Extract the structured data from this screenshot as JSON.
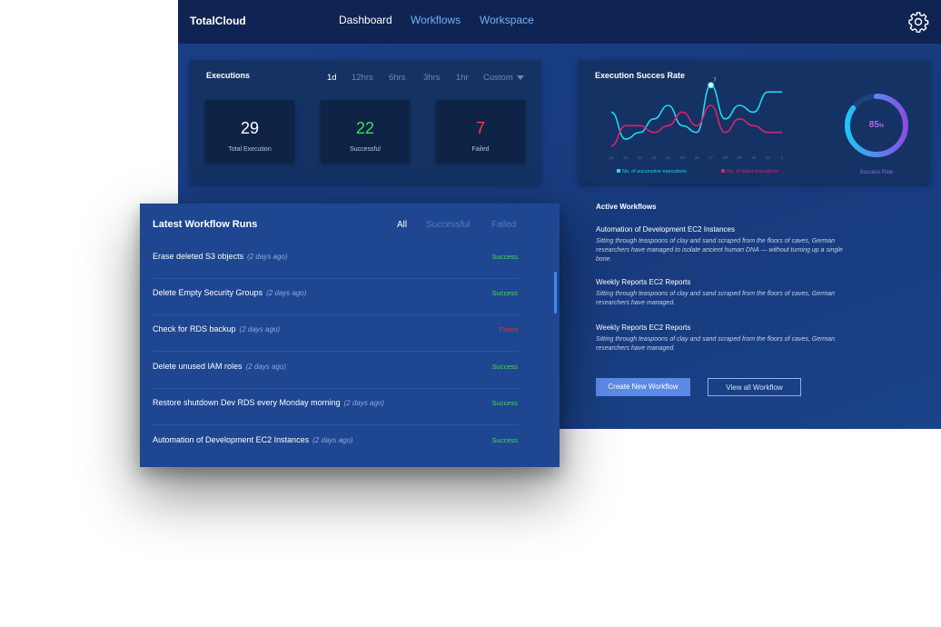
{
  "header": {
    "brand": "TotalCloud",
    "nav": [
      {
        "label": "Dashboard",
        "color": "#ffffff"
      },
      {
        "label": "Workflows",
        "color": "#6fb2ff"
      },
      {
        "label": "Workspace",
        "color": "#6fb2ff"
      }
    ],
    "settings_icon": "gear-icon"
  },
  "executions": {
    "title": "Executions",
    "ranges": [
      {
        "label": "1d",
        "active": true
      },
      {
        "label": "12hrs",
        "active": false
      },
      {
        "label": "6hrs",
        "active": false
      },
      {
        "label": "3hrs",
        "active": false
      },
      {
        "label": "1hr",
        "active": false
      },
      {
        "label": "Custom",
        "active": false
      }
    ],
    "stats": [
      {
        "value": "29",
        "label": "Total Execution",
        "color": "#ffffff"
      },
      {
        "value": "22",
        "label": "Successful",
        "color": "#3ee04a"
      },
      {
        "value": "7",
        "label": "Failed",
        "color": "#ff3b3b"
      }
    ]
  },
  "success_rate": {
    "title": "Execution Succes Rate",
    "ring_value": "85",
    "ring_unit": "%",
    "ring_label": "Success Rate",
    "ring_fraction": 0.85,
    "legend": [
      {
        "label": "No. of successive executions",
        "color": "#22d7f0"
      },
      {
        "label": "No. of failed executions",
        "color": "#e0206a"
      }
    ]
  },
  "chart_data": {
    "type": "line",
    "title": "Execution Succes Rate",
    "x": [
      "21",
      "21",
      "22",
      "23",
      "24",
      "25",
      "26",
      "27",
      "28",
      "29",
      "30",
      "31",
      "1"
    ],
    "series": [
      {
        "name": "No. of successive executions",
        "color": "#22d7f0",
        "values": [
          6,
          2,
          3,
          5,
          7,
          4,
          3,
          10,
          5,
          7,
          6,
          9,
          9
        ]
      },
      {
        "name": "No. of failed executions",
        "color": "#e0206a",
        "values": [
          1,
          4,
          4,
          3,
          4,
          6,
          4,
          7,
          3,
          5,
          4,
          3,
          3
        ]
      }
    ],
    "highlight_label": "7",
    "grid": false
  },
  "runs": {
    "title": "Latest Workflow Runs",
    "filters": [
      {
        "label": "All",
        "active": true
      },
      {
        "label": "Successful",
        "active": false
      },
      {
        "label": "Failed",
        "active": false
      }
    ],
    "items": [
      {
        "name": "Erase deleted S3 objects",
        "ago": "(2 days ago)",
        "status": "Success",
        "status_color": "#3ee04a"
      },
      {
        "name": "Delete Empty Security Groups",
        "ago": "(2 days ago)",
        "status": "Success",
        "status_color": "#3ee04a"
      },
      {
        "name": "Check for RDS backup",
        "ago": "(2 days ago)",
        "status": "Failed",
        "status_color": "#e0303a"
      },
      {
        "name": "Delete unused IAM roles",
        "ago": "(2 days ago)",
        "status": "Success",
        "status_color": "#3ee04a"
      },
      {
        "name": "Restore shutdown Dev RDS every Monday morning",
        "ago": "(2 days ago)",
        "status": "Success",
        "status_color": "#3ee04a"
      },
      {
        "name": "Automation of Development EC2 Instances",
        "ago": "(2 days ago)",
        "status": "Success",
        "status_color": "#3ee04a"
      }
    ]
  },
  "active_workflows": {
    "title": "Active Workflows",
    "items": [
      {
        "title": "Automation of Development EC2 Instances",
        "desc": "Sitting through teaspoons of clay and sand scraped from the floors of caves, German researchers have managed to isolate ancient human DNA — without turning up a single bone."
      },
      {
        "title": "Weekly Reports EC2 Reports",
        "desc": "Sitting through teaspoons of clay and sand scraped from the floors of caves, German researchers have managed."
      },
      {
        "title": "Weekly Reports EC2 Reports",
        "desc": "Sitting through teaspoons of clay and sand scraped from the floors of caves, German researchers have managed."
      }
    ],
    "create_button": "Create New Workflow",
    "view_button": "View all Workflow"
  }
}
